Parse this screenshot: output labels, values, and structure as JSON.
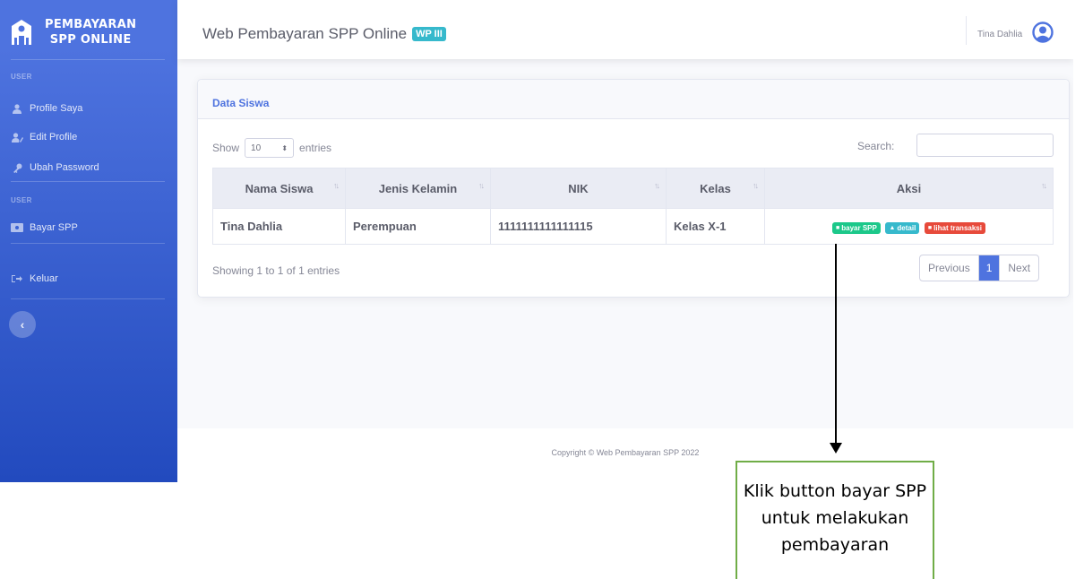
{
  "sidebar": {
    "brand": {
      "line1": "PEMBAYARAN",
      "line2": "SPP ONLINE",
      "icon": "school-icon"
    },
    "heading1": "USER",
    "items1": [
      {
        "label": "Profile Saya",
        "icon": "user-icon"
      },
      {
        "label": "Edit Profile",
        "icon": "user-edit-icon"
      },
      {
        "label": "Ubah Password",
        "icon": "key-icon"
      }
    ],
    "heading2": "USER",
    "items2": [
      {
        "label": "Bayar SPP",
        "icon": "money-icon"
      }
    ],
    "logout": {
      "label": "Keluar",
      "icon": "sign-out-icon"
    },
    "toggle_icon": "chevron-left-icon"
  },
  "topbar": {
    "title": "Web Pembayaran SPP Online",
    "badge": "WP III",
    "user_name": "Tina Dahlia",
    "avatar_icon": "user-circle-icon"
  },
  "card": {
    "title": "Data Siswa",
    "show_label": "Show",
    "entries_value": "10",
    "entries_label": "entries",
    "search_label": "Search:",
    "search_value": "",
    "columns": [
      "Nama Siswa",
      "Jenis Kelamin",
      "NIK",
      "Kelas",
      "Aksi"
    ],
    "rows": [
      {
        "nama": "Tina Dahlia",
        "jenis_kelamin": "Perempuan",
        "nik": "1111111111111115",
        "kelas": "Kelas X-1",
        "actions": [
          "bayar SPP",
          "detail",
          "lihat transaksi"
        ]
      }
    ],
    "info": "Showing 1 to 1 of 1 entries",
    "pager": {
      "previous": "Previous",
      "current": "1",
      "next": "Next"
    }
  },
  "footer": {
    "copyright": "Copyright © Web Pembayaran SPP 2022"
  },
  "annotation": {
    "line1": "Klik button bayar SPP",
    "line2": "untuk melakukan",
    "line3": "pembayaran"
  },
  "colors": {
    "primary": "#4e73df",
    "success": "#1cc88a",
    "info": "#36b9cc",
    "danger": "#e74a3b",
    "callout_border": "#70ad47"
  }
}
